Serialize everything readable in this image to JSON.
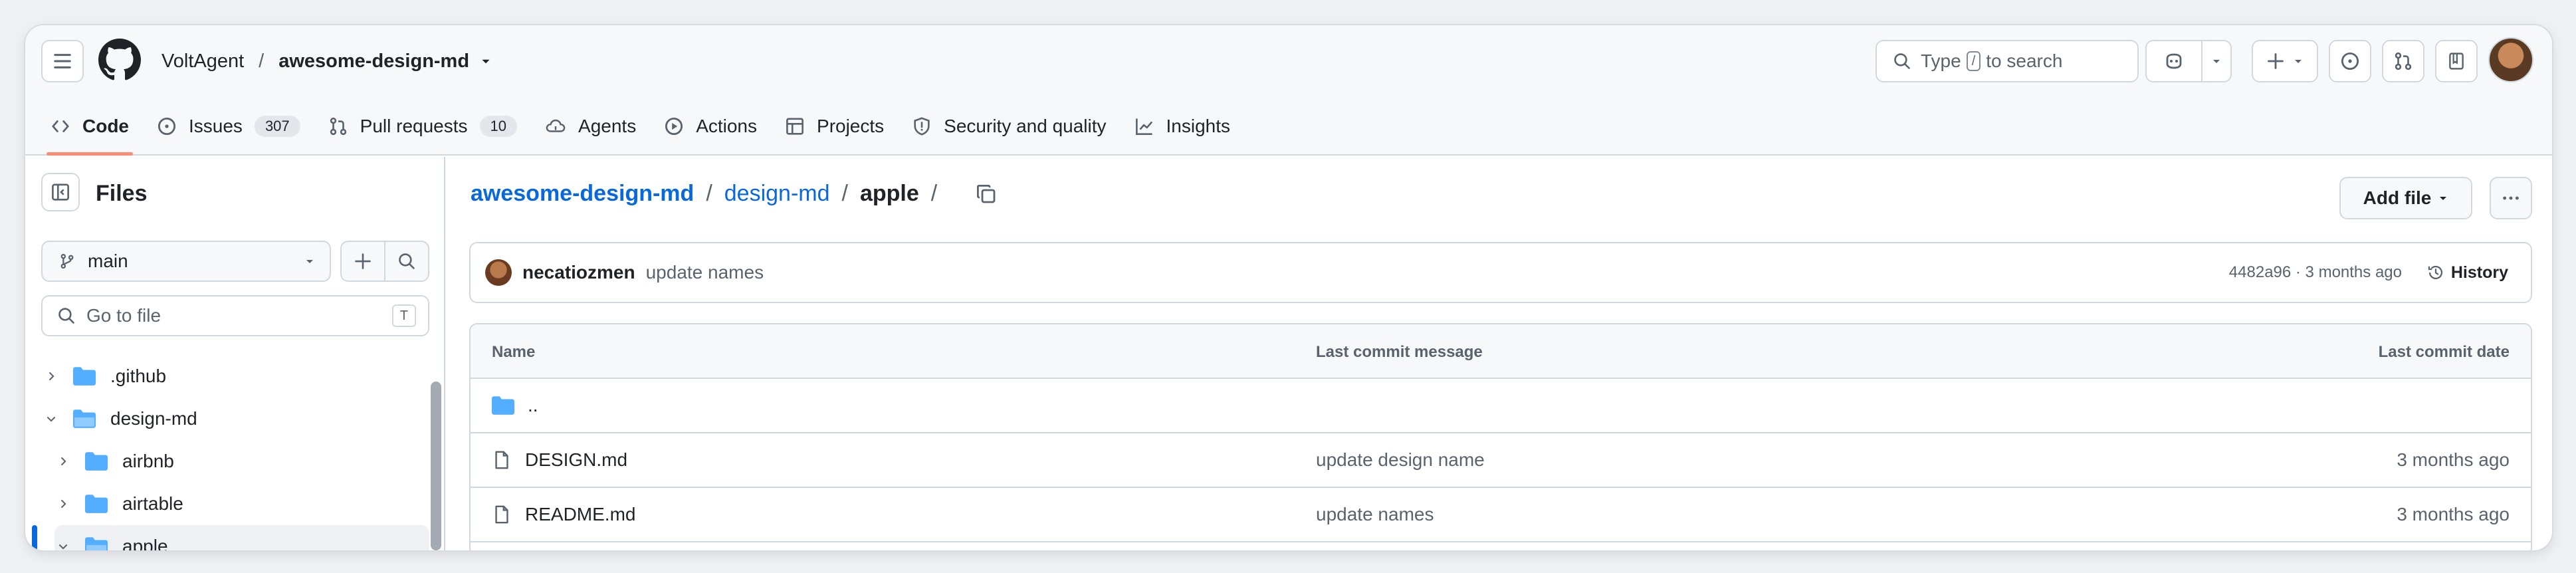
{
  "header": {
    "owner": "VoltAgent",
    "separator": "/",
    "repo": "awesome-design-md",
    "search": {
      "prefix": "Type",
      "key": "/",
      "suffix": "to search"
    }
  },
  "tabs": [
    {
      "label": "Code",
      "active": true,
      "icon": "code-icon"
    },
    {
      "label": "Issues",
      "count": "307",
      "icon": "issue-opened-icon"
    },
    {
      "label": "Pull requests",
      "count": "10",
      "icon": "git-pull-request-icon"
    },
    {
      "label": "Agents",
      "icon": "agent-icon"
    },
    {
      "label": "Actions",
      "icon": "play-icon"
    },
    {
      "label": "Projects",
      "icon": "table-icon"
    },
    {
      "label": "Security and quality",
      "icon": "shield-icon"
    },
    {
      "label": "Insights",
      "icon": "graph-icon"
    }
  ],
  "sidebar": {
    "title": "Files",
    "branch": "main",
    "goto_placeholder": "Go to file",
    "goto_key": "T",
    "tree": [
      {
        "label": ".github",
        "expanded": false
      },
      {
        "label": "design-md",
        "expanded": true
      },
      {
        "label": "airbnb",
        "expanded": false
      },
      {
        "label": "airtable",
        "expanded": false
      },
      {
        "label": "apple",
        "expanded": true,
        "selected": true
      }
    ]
  },
  "main": {
    "breadcrumb": {
      "root": "awesome-design-md",
      "sep": "/",
      "mid": "design-md",
      "current": "apple"
    },
    "add_file": "Add file",
    "commit": {
      "author": "necatiozmen",
      "message": "update names",
      "meta": "4482a96 · 3 months ago",
      "history": "History"
    },
    "table": {
      "columns": [
        "Name",
        "Last commit message",
        "Last commit date"
      ],
      "parent_row": "..",
      "rows": [
        {
          "name": "DESIGN.md",
          "message": "update design name",
          "date": "3 months ago"
        },
        {
          "name": "README.md",
          "message": "update names",
          "date": "3 months ago"
        }
      ]
    }
  },
  "colors": {
    "accent": "#0969da",
    "tab_underline": "#fd8c73",
    "folder": "#54aeff"
  }
}
